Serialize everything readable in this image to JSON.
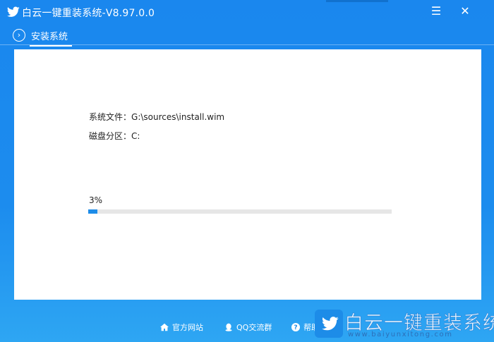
{
  "window": {
    "title": "白云一键重装系统-V8.97.0.0",
    "menu_icon": "hamburger-menu-icon",
    "close_icon": "close-icon",
    "menu_glyph": "☰",
    "close_glyph": "✕"
  },
  "tab": {
    "label": "安装系统",
    "icon": "chevron-right-circle-icon",
    "glyph": "›"
  },
  "install": {
    "file_label": "系统文件：",
    "file_value": "G:\\sources\\install.wim",
    "partition_label": "磁盘分区：",
    "partition_value": "C:",
    "progress_text": "3%",
    "progress_fraction": 0.03
  },
  "footer": {
    "links": [
      {
        "label": "官方网站",
        "icon": "home-icon"
      },
      {
        "label": "QQ交流群",
        "icon": "qq-penguin-icon"
      },
      {
        "label": "帮助",
        "icon": "help-icon"
      }
    ]
  },
  "watermark": {
    "name": "白云一键重装系统",
    "url": "www.baiyunxitong.com"
  },
  "colors": {
    "accent": "#1a87ee",
    "progress_fill": "#1d8ce8",
    "progress_track": "#e6e6e6"
  }
}
